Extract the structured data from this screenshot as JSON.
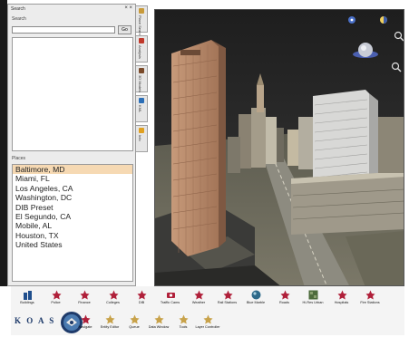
{
  "panel": {
    "title": "Search",
    "close_glyph": "× ×",
    "search_label": "Search",
    "search_value": "",
    "go_label": "Go",
    "places_label": "Places"
  },
  "places": [
    "Baltimore, MD",
    "Miami, FL",
    "Los Angeles, CA",
    "Washington, DC",
    "DIB Preset",
    "El Segundo, CA",
    "Mobile, AL",
    "Houston, TX",
    "United States"
  ],
  "selected_place_index": 0,
  "vertical_tabs": [
    {
      "label": "Place Search",
      "icon": "search-icon",
      "color": "#c89a3a"
    },
    {
      "label": "Analysis",
      "icon": "chart-icon",
      "color": "#c0392b"
    },
    {
      "label": "3D Models",
      "icon": "cube-icon",
      "color": "#7a4a2a"
    },
    {
      "label": "KML",
      "icon": "layers-icon",
      "color": "#2c6fb7"
    },
    {
      "label": "Info",
      "icon": "info-icon",
      "color": "#e0a020"
    }
  ],
  "toolbar_top": [
    {
      "name": "buildings",
      "label": "Buildings",
      "icon": "buildings-icon",
      "color": "#1f4e8c"
    },
    {
      "name": "police",
      "label": "Police",
      "icon": "police-icon",
      "color": "#b0203a"
    },
    {
      "name": "finance",
      "label": "Finance",
      "icon": "finance-icon",
      "color": "#b0203a"
    },
    {
      "name": "colleges",
      "label": "Colleges",
      "icon": "colleges-icon",
      "color": "#b0203a"
    },
    {
      "name": "dib",
      "label": "DIB",
      "icon": "dib-icon",
      "color": "#b0203a"
    },
    {
      "name": "traffic-cams",
      "label": "Traffic Cams",
      "icon": "camera-icon",
      "color": "#b0203a"
    },
    {
      "name": "weather",
      "label": "Weather",
      "icon": "weather-icon",
      "color": "#b0203a"
    },
    {
      "name": "rail-stations",
      "label": "Rail Stations",
      "icon": "rail-icon",
      "color": "#b0203a"
    },
    {
      "name": "blue-marble",
      "label": "Blue Marble",
      "icon": "globe-icon",
      "color": "#2e6a8a"
    },
    {
      "name": "roads",
      "label": "Roads",
      "icon": "roads-icon",
      "color": "#b0203a"
    },
    {
      "name": "hi-res-urban",
      "label": "Hi-Res Urban",
      "icon": "imagery-icon",
      "color": "#4d6b3c"
    },
    {
      "name": "hospitals",
      "label": "Hospitals",
      "icon": "hospital-icon",
      "color": "#b0203a"
    },
    {
      "name": "fire-stations",
      "label": "Fire Stations",
      "icon": "fire-icon",
      "color": "#b0203a"
    }
  ],
  "toolbar_bottom": {
    "logo_text": "K O A S",
    "seal_icon": "dhs-seal-icon",
    "tools": [
      {
        "name": "navigate",
        "label": "Navigate",
        "icon": "navigate-icon",
        "color": "#b0203a"
      },
      {
        "name": "entity-editor",
        "label": "Entity Editor",
        "icon": "entity-editor-icon",
        "color": "#c8a24a"
      },
      {
        "name": "queue",
        "label": "Queue",
        "icon": "queue-icon",
        "color": "#c8a24a"
      },
      {
        "name": "data-window",
        "label": "Data Window",
        "icon": "data-window-icon",
        "color": "#c8a24a"
      },
      {
        "name": "tools",
        "label": "Tools",
        "icon": "tools-icon",
        "color": "#c8a24a"
      },
      {
        "name": "layer-controller",
        "label": "Layer Controller",
        "icon": "layers-icon",
        "color": "#c8a24a"
      }
    ]
  },
  "map": {
    "scene": "3D city view",
    "controls": [
      "compass-icon",
      "sun-icon",
      "zoom-in-icon",
      "navigation-globe-icon",
      "zoom-out-icon"
    ]
  }
}
